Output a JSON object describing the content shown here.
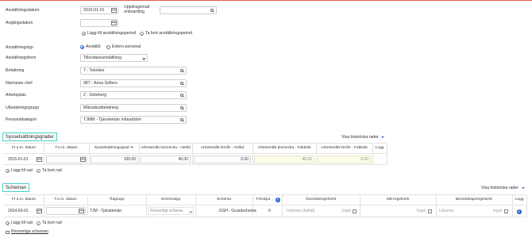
{
  "form": {
    "anstallningsdatum_label": "Anställningsdatum",
    "anstallningsdatum_value": "2015-01-01",
    "uppdragsmail_label_1": "Uppdragsmail",
    "uppdragsmail_label_2": "onboarding",
    "avgangsdatum_label": "Avgångsdatum",
    "lagg_till_period": "Lägg till anställningsperiod",
    "ta_bort_period": "Ta bort anställningsperiod",
    "anstallningstyp_label": "Anställningstyp",
    "anstalld_option": "Anställd",
    "extern_option": "Extern personal",
    "anstallningsform_label": "Anställningsform",
    "anstallningsform_value": "Tillsvidareanställning",
    "befattning_label": "Befattning",
    "befattning_value": "7 - Tekniker",
    "narmaste_chef_label": "Närmaste chef",
    "narmaste_chef_value": "987 - Anna Sofiero",
    "arbetsplats_label": "Arbetsplats",
    "arbetsplats_value": "2 - Göteborg",
    "utbetalningsgrupp_label": "Utbetalningsgrupp",
    "utbetalningsgrupp_value": "Månadsutbetalning",
    "personalkategori_label": "Personalkategori",
    "personalkategori_value": "TJMM - Tjänstemän månadslön"
  },
  "syssel": {
    "title": "Sysselsättningsgrader",
    "history_link": "Visa historiska rader",
    "headers": [
      "Fr.o.m. datum",
      "T.o.m. datum",
      "Sysselsättningsgrad %",
      "Arbetsmått tim/vecka - Heltid",
      "Arbetsmått tim/år - Heltid",
      "Arbetsmått tim/vecka - Faktiskt",
      "Arbetsmått tim/år - Faktiskt",
      "Logg"
    ],
    "row": {
      "from": "2015-01-01",
      "to": "",
      "grad": "100,00",
      "vecka_heltid": "40,00",
      "ar_heltid": "0,00",
      "vecka_faktiskt": "40,00",
      "ar_faktiskt": "0,00"
    },
    "add_row": "Lägg till rad",
    "remove_row": "Ta bort rad"
  },
  "scheman": {
    "title": "Scheman",
    "history_link": "Visa historiska rader",
    "headers": [
      "Fr.o.m. datum",
      "T.o.m. datum",
      "Tidgrupp",
      "Schematyp",
      "Schema",
      "Förskjut",
      "Övertidsregelverk",
      "OB-regelverk",
      "Beredskapsregelverk",
      "Logg"
    ],
    "row": {
      "from": "2024-03-01",
      "to": "",
      "tidgrupp": "TJM - Tjänstemän",
      "schematyp": "Personligt schema",
      "schema": "GSH - Grundschema",
      "forskjut": "0",
      "overtid_placeholder": "Unionen (heltid)",
      "overtid_ingel": "Inget",
      "ob_ingel": "Inget",
      "beredskap_placeholder": "Unionen",
      "beredskap_ingel": "Inget"
    },
    "add_row": "Lägg till rad",
    "remove_row": "Ta bort rad",
    "personal_link": "Personliga scheman"
  },
  "colors": {
    "accent": "#2b6cc4",
    "section_border": "#3fd3c5",
    "topline": "#e25b4b"
  }
}
